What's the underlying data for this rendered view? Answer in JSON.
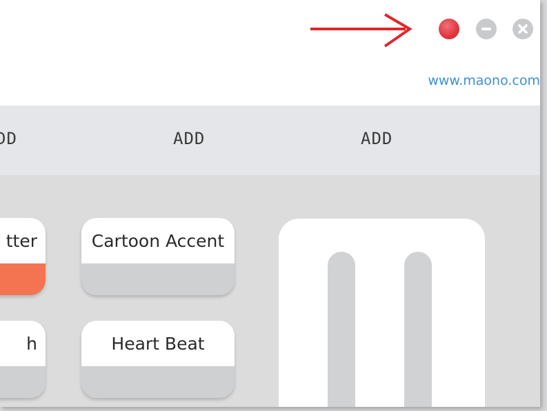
{
  "header": {
    "website": "www.maono.com"
  },
  "window_buttons": [
    {
      "name": "record",
      "color": "#e0353f",
      "icon": "record-dot-icon"
    },
    {
      "name": "minimize",
      "color": "#c9cacc",
      "icon": "minus-icon"
    },
    {
      "name": "close",
      "color": "#c9cacc",
      "icon": "x-icon"
    }
  ],
  "annotation": {
    "arrow_color": "#e1262a"
  },
  "add_row": {
    "labels": [
      "DD",
      "ADD",
      "ADD"
    ]
  },
  "sound_cards": [
    {
      "label": "tter",
      "accent": "#f47452"
    },
    {
      "label": "Cartoon Accent"
    },
    {
      "label": "h"
    },
    {
      "label": "Heart Beat"
    }
  ]
}
